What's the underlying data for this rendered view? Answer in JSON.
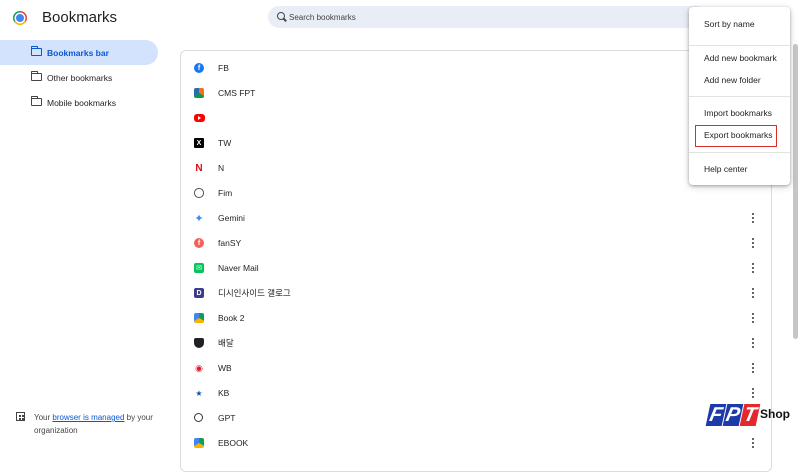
{
  "header": {
    "title": "Bookmarks",
    "search_placeholder": "Search bookmarks"
  },
  "sidebar": {
    "items": [
      {
        "label": "Bookmarks bar",
        "icon": "folder-icon",
        "active": true
      },
      {
        "label": "Other bookmarks",
        "icon": "folder-icon",
        "active": false
      },
      {
        "label": "Mobile bookmarks",
        "icon": "folder-icon",
        "active": false
      }
    ],
    "managed": {
      "prefix": "Your ",
      "link": "browser is managed",
      "suffix": " by your organization"
    }
  },
  "bookmarks": [
    {
      "title": "FB",
      "icon": "facebook-icon"
    },
    {
      "title": "CMS FPT",
      "icon": "cms-fpt-icon"
    },
    {
      "title": "",
      "icon": "youtube-icon"
    },
    {
      "title": "TW",
      "icon": "x-icon"
    },
    {
      "title": "N",
      "icon": "netflix-icon"
    },
    {
      "title": "Fim",
      "icon": "globe-icon"
    },
    {
      "title": "Gemini",
      "icon": "gemini-icon"
    },
    {
      "title": "fanSY",
      "icon": "fansy-icon"
    },
    {
      "title": "Naver Mail",
      "icon": "naver-mail-icon"
    },
    {
      "title": "디시인사이드 갤로그",
      "icon": "dcinside-icon"
    },
    {
      "title": "Book 2",
      "icon": "drive-icon"
    },
    {
      "title": "배달",
      "icon": "shield-icon"
    },
    {
      "title": "WB",
      "icon": "weibo-icon"
    },
    {
      "title": "KB",
      "icon": "kb-icon"
    },
    {
      "title": "GPT",
      "icon": "gpt-icon"
    },
    {
      "title": "EBOOK",
      "icon": "drive-icon"
    }
  ],
  "menu": {
    "sort_by_name": "Sort by name",
    "add_new_bookmark": "Add new bookmark",
    "add_new_folder": "Add new folder",
    "import_bookmarks": "Import bookmarks",
    "export_bookmarks": "Export bookmarks",
    "help_center": "Help center"
  },
  "watermark": {
    "letters": [
      "F",
      "P",
      "T"
    ],
    "word": "Shop"
  },
  "colors": {
    "accent": "#0b57d0",
    "active_bg": "#d3e3fd",
    "highlight_border": "#d93025",
    "search_bg": "#e9eef6"
  }
}
